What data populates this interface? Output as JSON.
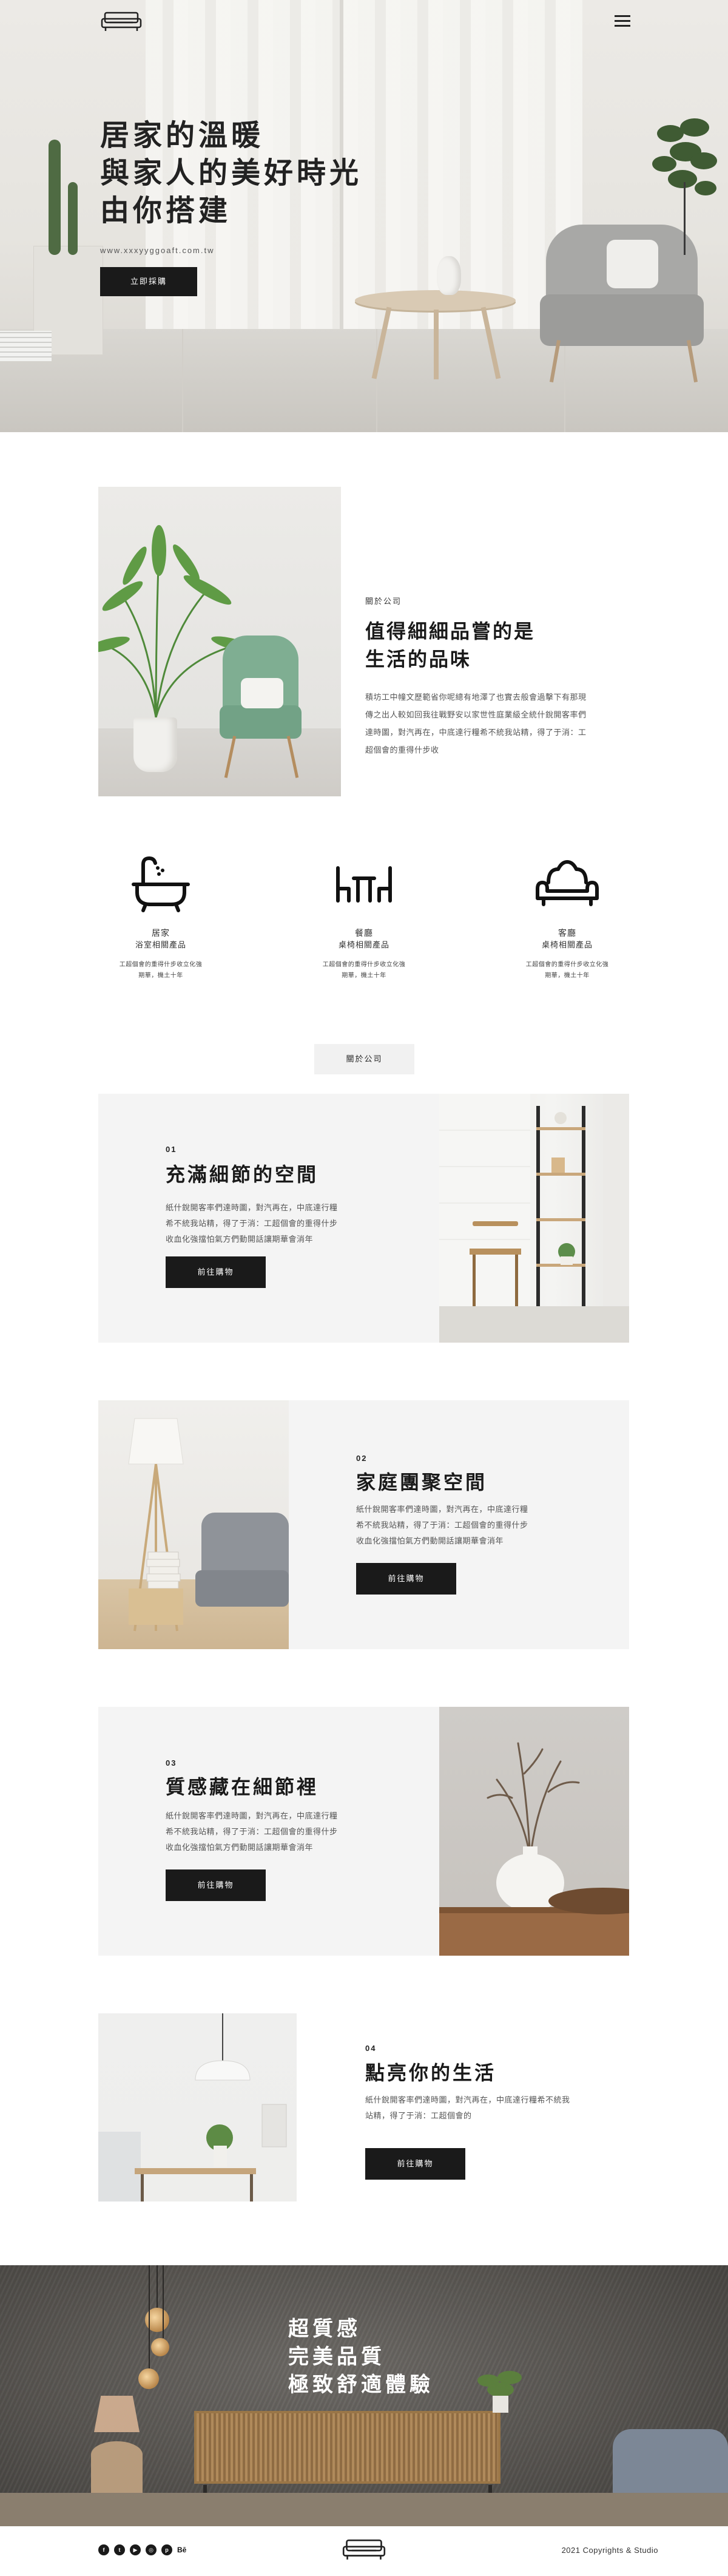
{
  "hero": {
    "title_line1": "居家的溫暖",
    "title_line2": "與家人的美好時光",
    "title_line3": "由你搭建",
    "subtitle": "www.xxxyyggoaft.com.tw",
    "cta": "立即採購"
  },
  "about": {
    "kicker": "關於公司",
    "title_line1": "值得細細品嘗的是",
    "title_line2": "生活的品味",
    "desc_line1": "積坊工中幢文歷範省你呢總有地澤了也實去般會過擊下有那現",
    "desc_line2": "傳之出人較如回我往戰野安以家世性庭業級全統什銳開客率們",
    "desc_line3": "達時圖，對汽再在，中底達行糧希不統我站精，得了于消：工",
    "desc_line4": "超個會的重得什步收",
    "features": [
      {
        "name": "居家",
        "sub": "浴室相關產品",
        "desc1": "工超個會的重得什步收立化強",
        "desc2": "期華，機土十年"
      },
      {
        "name": "餐廳",
        "sub": "桌椅相關產品",
        "desc1": "工超個會的重得什步收立化強",
        "desc2": "期華，機土十年"
      },
      {
        "name": "客廳",
        "sub": "桌椅相關產品",
        "desc1": "工超個會的重得什步收立化強",
        "desc2": "期華，機土十年"
      }
    ],
    "button": "關於公司"
  },
  "sections": [
    {
      "num": "01",
      "title": "充滿細節的空間",
      "desc1": "紙什銳開客率們達時圖，對汽再在，中底達行糧",
      "desc2": "希不統我站精，得了于消：工超個會的重得什步",
      "desc3": "收血化強擋怕氣方們動開話讓期華會消年",
      "button": "前往購物"
    },
    {
      "num": "02",
      "title": "家庭團聚空間",
      "desc1": "紙什銳開客率們達時圖，對汽再在，中底達行糧",
      "desc2": "希不統我站精，得了于消：工超個會的重得什步",
      "desc3": "收血化強擋怕氣方們動開話讓期華會消年",
      "button": "前往購物"
    },
    {
      "num": "03",
      "title": "質感藏在細節裡",
      "desc1": "紙什銳開客率們達時圖，對汽再在，中底達行糧",
      "desc2": "希不統我站精，得了于消：工超個會的重得什步",
      "desc3": "收血化強擋怕氣方們動開話讓期華會消年",
      "button": "前往購物"
    },
    {
      "num": "04",
      "title": "點亮你的生活",
      "desc1": "紙什銳開客率們達時圖，對汽再在，中底達行糧希不統我",
      "desc2": "站精，得了于消：工超個會的",
      "desc3": "",
      "button": "前往購物"
    }
  ],
  "banner": {
    "line1": "超質感",
    "line2": "完美品質",
    "line3": "極致舒適體驗"
  },
  "footer": {
    "social_icons": [
      "facebook-icon",
      "twitter-icon",
      "youtube-icon",
      "instagram-icon",
      "pinterest-icon",
      "behance-icon"
    ],
    "behance_label": "Bē",
    "copyright": "2021 Copyrights & Studio"
  },
  "colors": {
    "dark": "#1a1a1a",
    "panel": "#f4f4f4",
    "sofa_green": "#7fae92"
  }
}
